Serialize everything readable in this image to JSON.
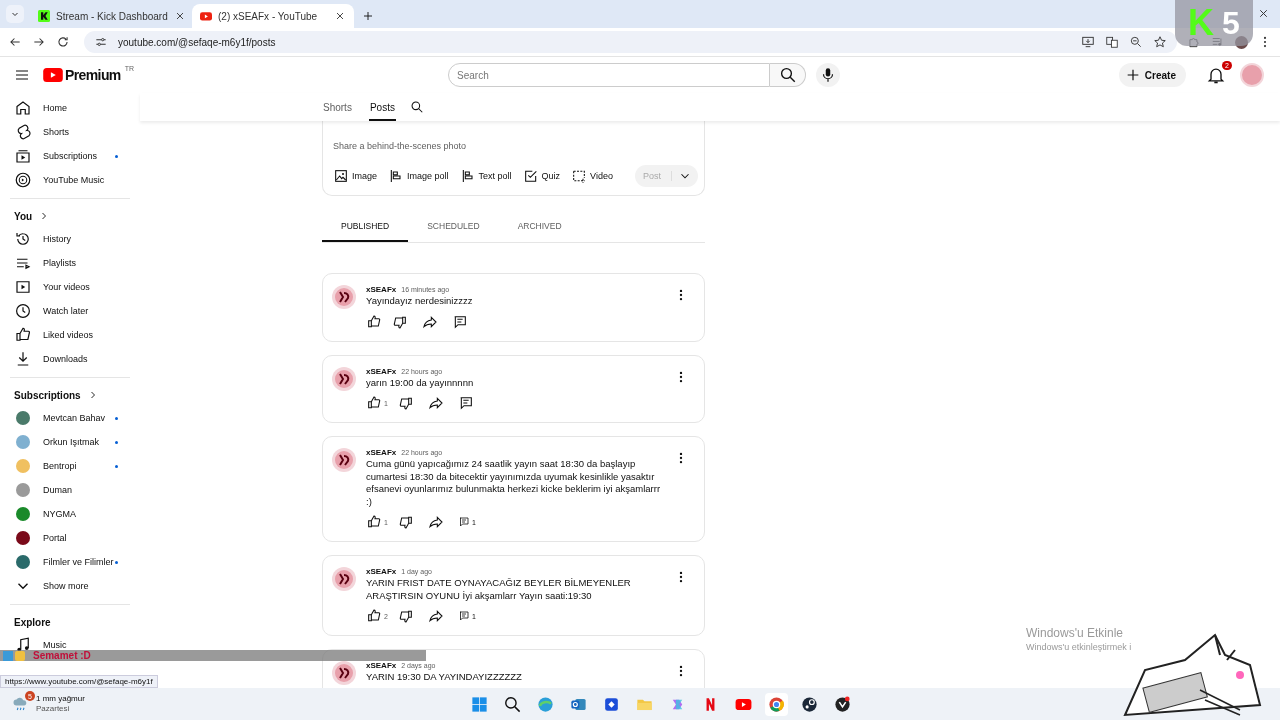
{
  "browser": {
    "tabs": [
      {
        "title": "Stream - Kick Dashboard",
        "kind": "kick",
        "selected": false
      },
      {
        "title": "(2) xSEAFx - YouTube",
        "kind": "youtube",
        "selected": true
      }
    ],
    "url": "youtube.com/@sefaqe-m6y1f/posts"
  },
  "header": {
    "logo": "Premium",
    "country": "TR",
    "search": {
      "placeholder": "Search"
    },
    "create": "Create",
    "notifications": "2"
  },
  "sidebar": {
    "main": [
      {
        "label": "Home",
        "new": false
      },
      {
        "label": "Shorts",
        "new": false
      },
      {
        "label": "Subscriptions",
        "new": true
      },
      {
        "label": "YouTube Music",
        "new": false
      }
    ],
    "you": {
      "title": "You",
      "items": [
        {
          "label": "History"
        },
        {
          "label": "Playlists"
        },
        {
          "label": "Your videos"
        },
        {
          "label": "Watch later"
        },
        {
          "label": "Liked videos"
        },
        {
          "label": "Downloads"
        }
      ]
    },
    "subscriptions": {
      "title": "Subscriptions",
      "items": [
        {
          "label": "Mevtcan Bahav",
          "color": "#4a7a6a",
          "new": true
        },
        {
          "label": "Orkun Işıtmak",
          "color": "#7fb0d0",
          "new": true
        },
        {
          "label": "Bentropi",
          "color": "#f0c060",
          "new": true
        },
        {
          "label": "Duman",
          "color": "#9a9a9a",
          "new": false
        },
        {
          "label": "NYGMA",
          "color": "#1a8a2a",
          "new": false
        },
        {
          "label": "Portal",
          "color": "#7a0a1a",
          "new": false
        },
        {
          "label": "Filmler ve Filimler",
          "color": "#2a6a6a",
          "new": true
        }
      ],
      "more": "Show more"
    },
    "explore": {
      "title": "Explore",
      "items": [
        {
          "label": "Music"
        }
      ]
    }
  },
  "channel_tabs": [
    {
      "label": "Shorts",
      "selected": false
    },
    {
      "label": "Posts",
      "selected": true
    }
  ],
  "composer": {
    "placeholder": "Share a behind-the-scenes photo",
    "actions": [
      {
        "label": "Image"
      },
      {
        "label": "Image poll"
      },
      {
        "label": "Text poll"
      },
      {
        "label": "Quiz"
      },
      {
        "label": "Video"
      }
    ],
    "post": "Post",
    "post_disabled": true
  },
  "post_tabs": [
    {
      "label": "PUBLISHED",
      "selected": true
    },
    {
      "label": "SCHEDULED",
      "selected": false
    },
    {
      "label": "ARCHIVED",
      "selected": false
    }
  ],
  "posts": [
    {
      "author": "xSEAFx",
      "time": "16 minutes ago",
      "text": "Yayındayız nerdesinizzzz"
    },
    {
      "author": "xSEAFx",
      "time": "22 hours ago",
      "text": "yarın 19:00 da yayınnnnn",
      "likes": "1"
    },
    {
      "author": "xSEAFx",
      "time": "22 hours ago",
      "text": "Cuma günü yapıcağımız 24 saatlik yayın saat 18:30 da başlayıp cumartesi 18:30 da bitecektir yayınımızda uyumak kesinlikle yasaktır efsanevi oyunlarımız bulunmakta herkezi kicke beklerim iyi akşamlarrr :)",
      "likes": "1",
      "comments": "1"
    },
    {
      "author": "xSEAFx",
      "time": "1 day ago",
      "text": "YARIN FRIST DATE OYNAYACAĞIZ BEYLER BİLMEYENLER ARAŞTIRSIN OYUNU İyi akşamlarr Yayın saati:19:30",
      "likes": "2",
      "comments": "1"
    },
    {
      "author": "xSEAFx",
      "time": "2 days ago",
      "text": "YARIN 19:30 DA YAYINDAYIZZZZZZ"
    }
  ],
  "status_url": "https://www.youtube.com/@sefaqe-m6y1f",
  "taskbar": {
    "weather": "1 mm yağmur",
    "day": "Pazartesi",
    "badge": "5"
  },
  "overlays": {
    "kick_letter": "K",
    "kick_count": "5",
    "caption": "Semamet :D",
    "activation_title": "Windows'u Etkinle",
    "activation_text": "Windows'u etkinleştirmek i"
  }
}
